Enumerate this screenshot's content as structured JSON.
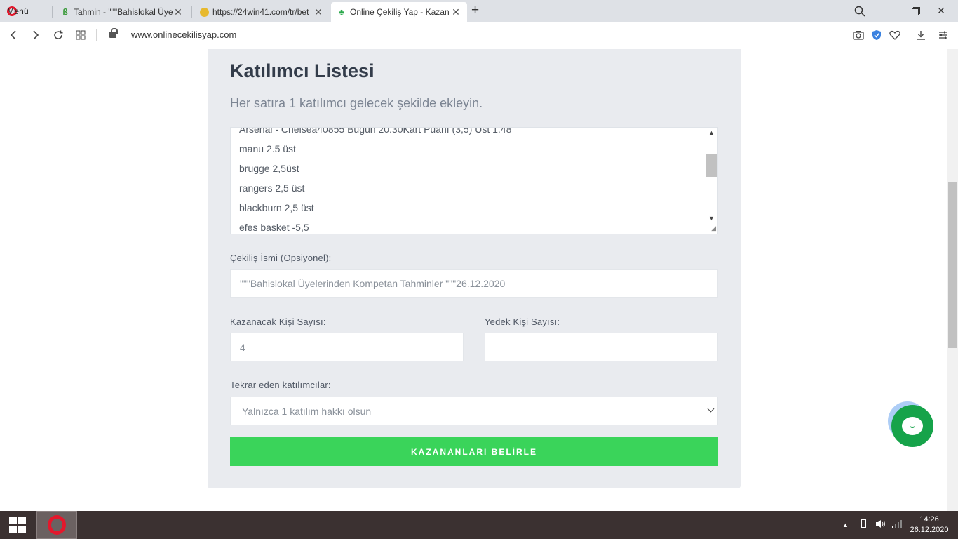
{
  "browser": {
    "menu_label": "Menü",
    "tabs": [
      {
        "title": "Tahmin - \"\"\"Bahislokal Üye",
        "icon": "green-leaf-icon"
      },
      {
        "title": "https://24win41.com/tr/bet",
        "icon": "yellow-coin-icon"
      },
      {
        "title": "Online Çekiliş Yap - Kazana",
        "icon": "clover-icon"
      }
    ],
    "url": "www.onlinecekilisyap.com"
  },
  "form": {
    "title": "Katılımcı Listesi",
    "subtitle": "Her satıra 1 katılımcı gelecek şekilde ekleyin.",
    "participants": [
      "Arsenal - Chelsea40855 Bugün 20:30Kart Puanı (3,5) Üst 1.48",
      "manu 2.5 üst",
      "brugge 2,5üst",
      "rangers 2,5 üst",
      "blackburn 2,5 üst",
      "efes basket -5,5"
    ],
    "draw_name_label": "Çekiliş İsmi (Opsiyonel):",
    "draw_name_value": "\"\"\"Bahislokal Üyelerinden Kompetan Tahminler \"\"\"26.12.2020",
    "winner_count_label": "Kazanacak Kişi Sayısı:",
    "winner_count_value": "4",
    "backup_count_label": "Yedek Kişi Sayısı:",
    "backup_count_value": "",
    "repeat_label": "Tekrar eden katılımcılar:",
    "repeat_value": "Yalnızca 1 katılım hakkı olsun",
    "submit_label": "KAZANANLARI BELİRLE"
  },
  "taskbar": {
    "time": "14:26",
    "date": "26.12.2020"
  },
  "colors": {
    "accent_green": "#3ad45a",
    "card_bg": "#e9ebef",
    "chat_green": "#16a34a"
  }
}
